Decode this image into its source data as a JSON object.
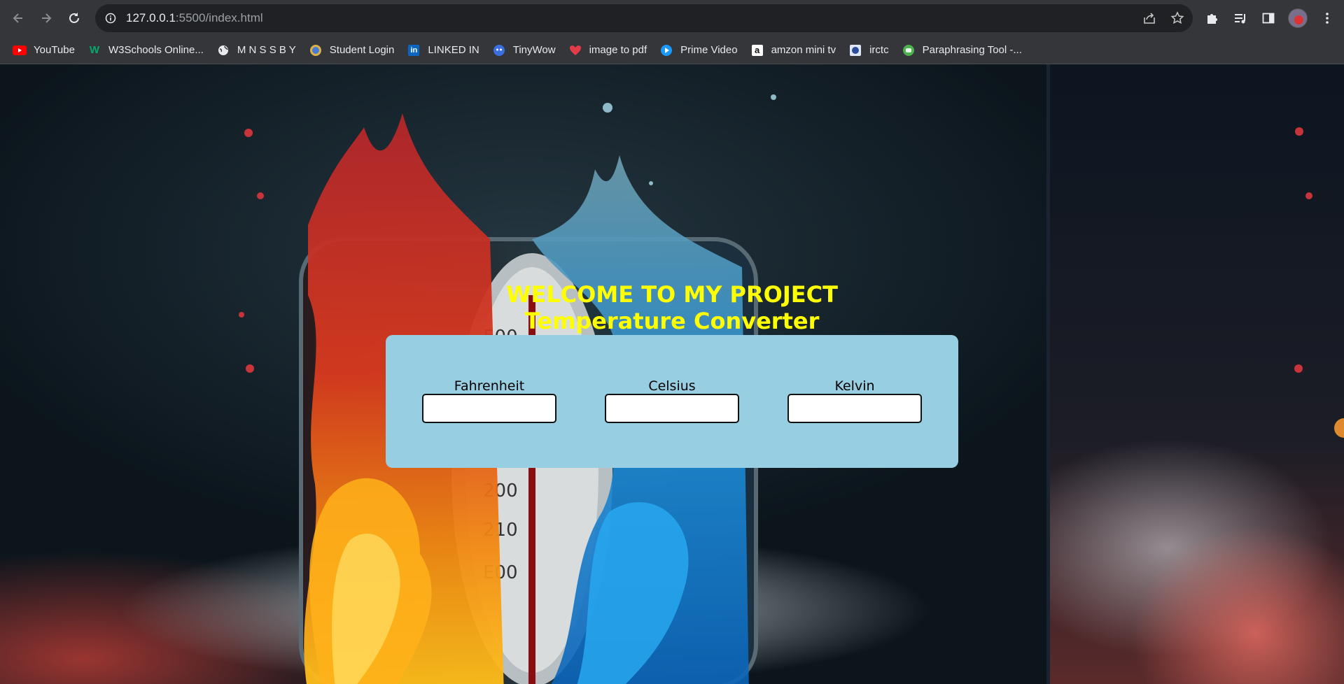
{
  "browser": {
    "url_host": "127.0.0.1",
    "url_path": ":5500/index.html",
    "bookmarks": [
      {
        "label": "YouTube",
        "icon": "youtube-icon",
        "color": "#ff0000"
      },
      {
        "label": "W3Schools Online...",
        "icon": "w3schools-icon",
        "color": "#04aa6d"
      },
      {
        "label": "M N S S B Y",
        "icon": "globe-icon",
        "color": "#e8eaed"
      },
      {
        "label": "Student Login",
        "icon": "student-login-icon",
        "color": "#4a7bd0"
      },
      {
        "label": "LINKED IN",
        "icon": "linkedin-icon",
        "color": "#0a66c2"
      },
      {
        "label": "TinyWow",
        "icon": "tinywow-icon",
        "color": "#3b6fe0"
      },
      {
        "label": "image to pdf",
        "icon": "heart-icon",
        "color": "#e23b4a"
      },
      {
        "label": "Prime Video",
        "icon": "prime-video-icon",
        "color": "#1a98ff"
      },
      {
        "label": "amzon mini tv",
        "icon": "amazon-icon",
        "color": "#ffffff"
      },
      {
        "label": "irctc",
        "icon": "irctc-icon",
        "color": "#8fa3d6"
      },
      {
        "label": "Paraphrasing Tool -...",
        "icon": "quillbot-icon",
        "color": "#4caf50"
      }
    ]
  },
  "page": {
    "title_line1": "WELCOME TO MY PROJECT",
    "title_line2": "Temperature Converter",
    "title_color": "#ffff00",
    "card_color": "#98cee2",
    "fields": {
      "fahrenheit": {
        "label": "Fahrenheit",
        "value": ""
      },
      "celsius": {
        "label": "Celsius",
        "value": ""
      },
      "kelvin": {
        "label": "Kelvin",
        "value": ""
      }
    }
  }
}
